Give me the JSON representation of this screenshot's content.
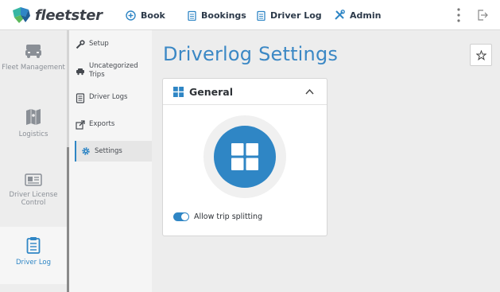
{
  "brand": {
    "name": "fleetster"
  },
  "topnav": {
    "items": [
      {
        "label": "Book",
        "icon": "plus-circle-icon"
      },
      {
        "label": "Bookings",
        "icon": "clipboard-icon"
      },
      {
        "label": "Driver Log",
        "icon": "clipboard-icon"
      },
      {
        "label": "Admin",
        "icon": "tools-icon"
      }
    ],
    "more_icon": "kebab-menu-icon",
    "logout_icon": "logout-icon"
  },
  "sidebar": {
    "items": [
      {
        "label": "Fleet Management",
        "icon": "cars-icon",
        "active": false
      },
      {
        "label": "Logistics",
        "icon": "map-icon",
        "active": false
      },
      {
        "label": "Driver License Control",
        "icon": "id-card-icon",
        "active": false
      },
      {
        "label": "Driver Log",
        "icon": "clipboard-icon",
        "active": true
      }
    ]
  },
  "subnav": {
    "items": [
      {
        "label": "Setup",
        "icon": "wrench-icon",
        "active": false
      },
      {
        "label": "Uncategorized Trips",
        "icon": "car-question-icon",
        "active": false
      },
      {
        "label": "Driver Logs",
        "icon": "document-icon",
        "active": false
      },
      {
        "label": "Exports",
        "icon": "export-icon",
        "active": false
      },
      {
        "label": "Settings",
        "icon": "gear-icon",
        "active": true
      }
    ]
  },
  "page": {
    "title": "Driverlog Settings",
    "favorite_icon": "star-icon"
  },
  "card": {
    "title": "General",
    "icon": "grid-icon",
    "collapse_icon": "chevron-up-icon",
    "toggle": {
      "label": "Allow trip splitting",
      "on": true
    }
  },
  "colors": {
    "accent": "#2f86c5",
    "title": "#3b88c5",
    "background": "#ededed"
  }
}
